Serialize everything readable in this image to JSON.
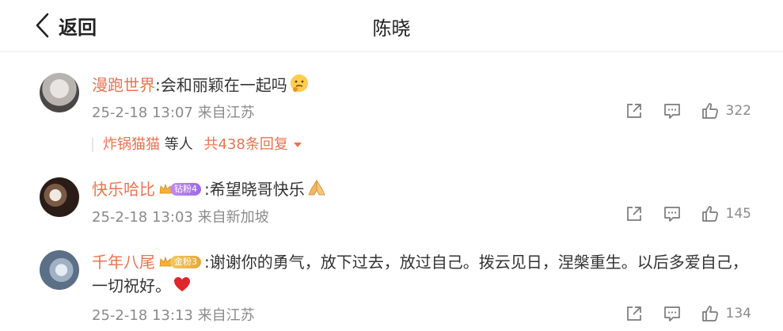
{
  "header": {
    "back_label": "返回",
    "title": "陈晓"
  },
  "comments": [
    {
      "username": "漫跑世界",
      "text": ":会和丽颖在一起吗",
      "emoji": "thinking-face",
      "time": "25-2-18 13:07",
      "location": "来自江苏",
      "likes": "322",
      "replies": {
        "who": "炸锅猫猫",
        "suffix": "等人",
        "count_text": "共438条回复"
      }
    },
    {
      "username": "快乐哈比",
      "badge": "钻粉4",
      "badge_color": "#a57ae9",
      "text": ":希望晓哥快乐",
      "emoji": "praying-hands",
      "time": "25-2-18 13:03",
      "location": "来自新加坡",
      "likes": "145"
    },
    {
      "username": "千年八尾",
      "badge": "金粉3",
      "badge_color": "#eab545",
      "text_line1": ":谢谢你的勇气，放下过去，放过自己。拨云见日，涅槃重生。以后多爱自己，",
      "text_line2": "一切祝好。",
      "emoji": "red-heart",
      "time": "25-2-18 13:13",
      "location": "来自江苏",
      "likes": "134"
    }
  ],
  "colors": {
    "accent": "#eb7350",
    "meta": "#8a8a8a"
  }
}
